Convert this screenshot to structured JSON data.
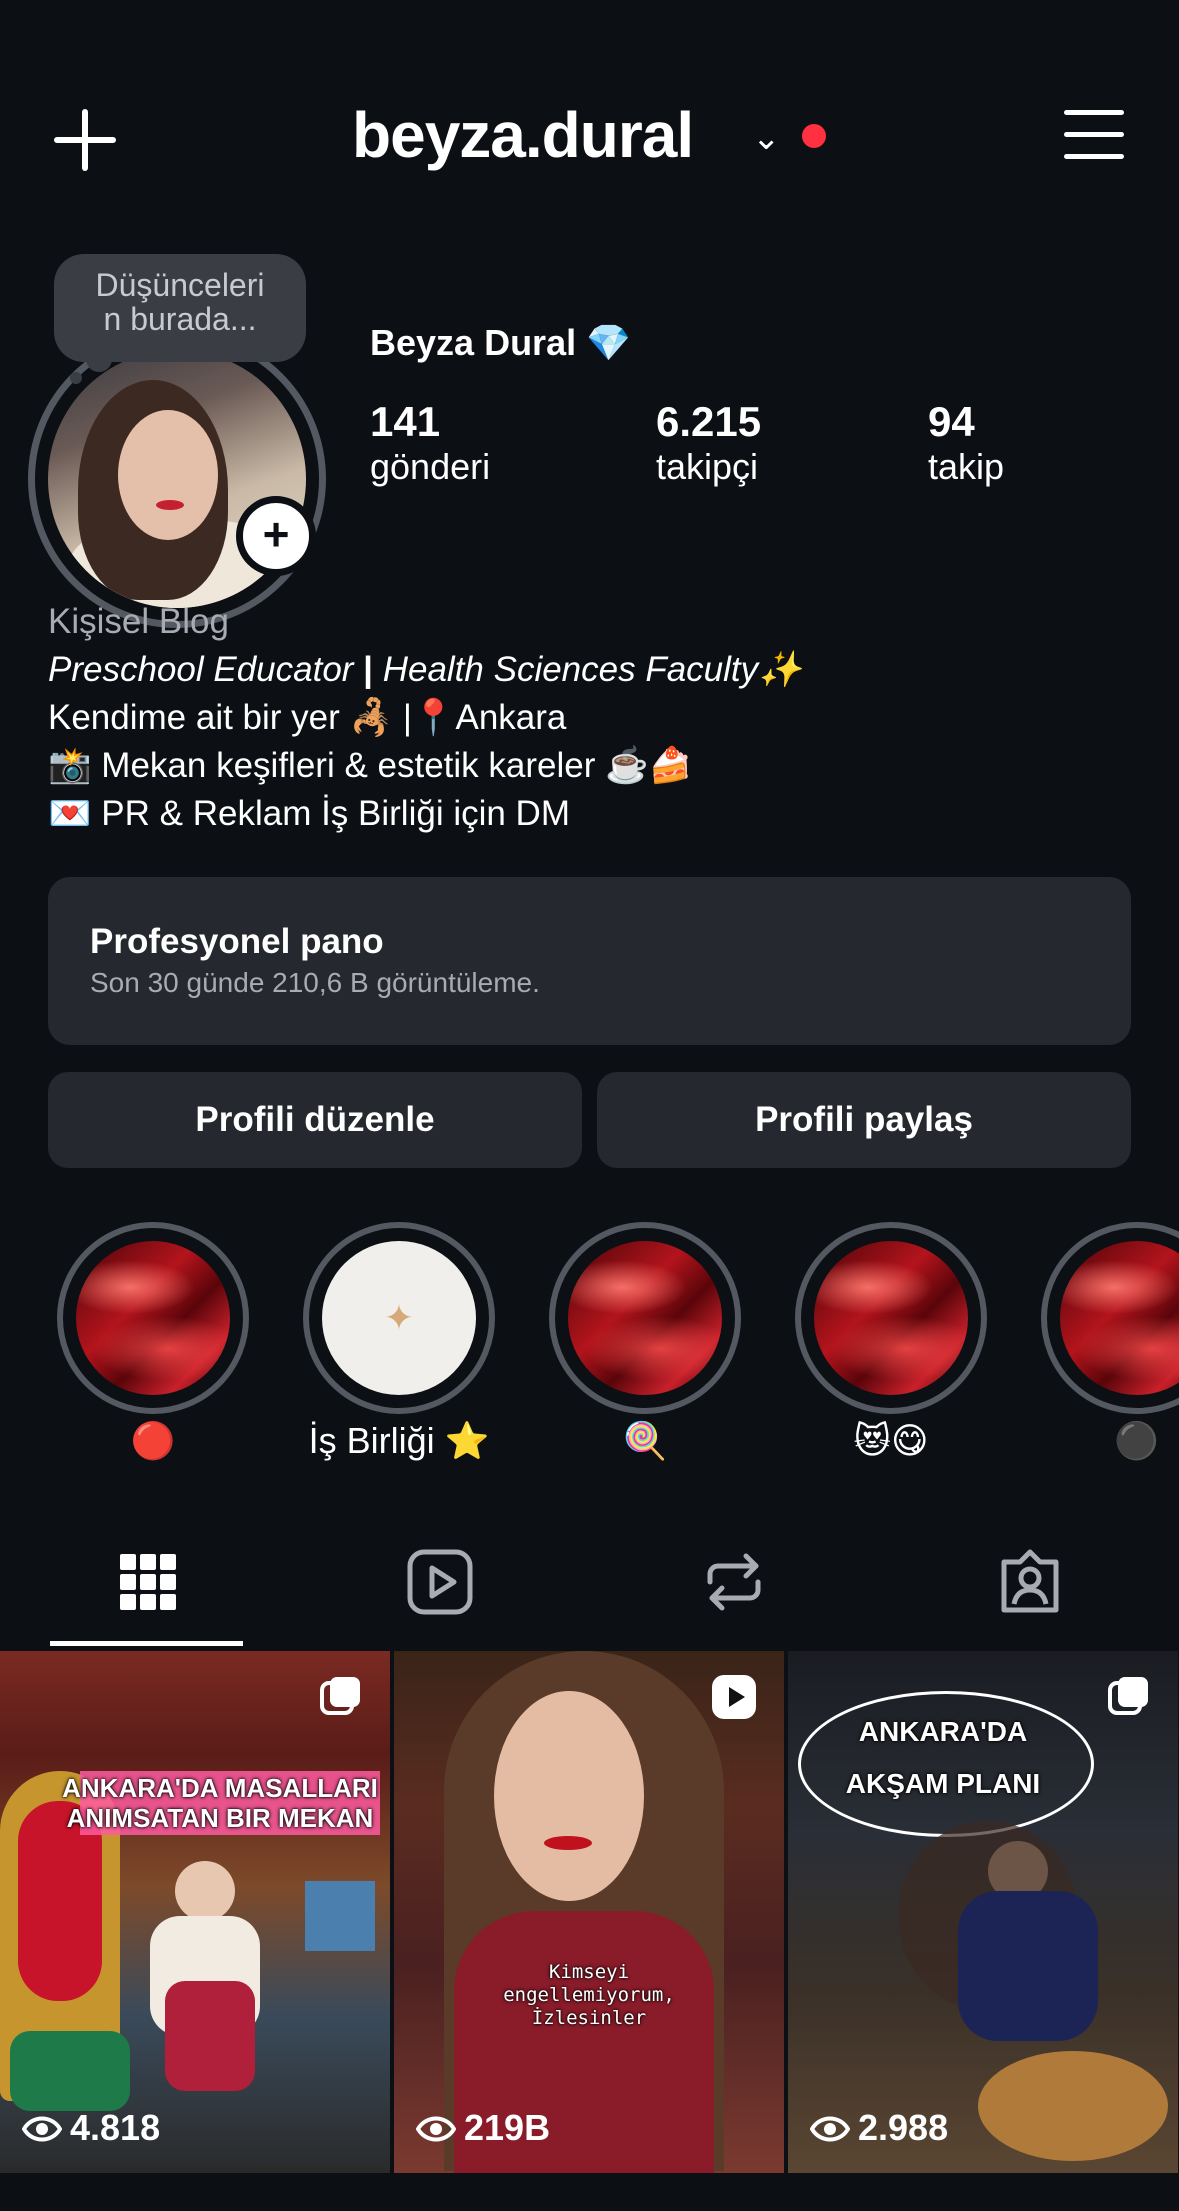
{
  "header": {
    "username": "beyza.dural",
    "chevron_icon": "chevron-down-icon",
    "notification_color": "#ff3040"
  },
  "profile": {
    "note_bubble": "Düşünceleri\nn burada...",
    "full_name": "Beyza Dural 💎",
    "stats": [
      {
        "value": "141",
        "label": "gönderi"
      },
      {
        "value": "6.215",
        "label": "takipçi"
      },
      {
        "value": "94",
        "label": "takip"
      }
    ],
    "category": "Kişisel Blog",
    "bio_line1_a": "Preschool Educator",
    "bio_line1_sep": " | ",
    "bio_line1_b": "Health Sciences Faculty✨",
    "bio_line2": "Kendime ait bir yer 🦂 |📍Ankara",
    "bio_line3": "📸 Mekan keşifleri & estetik kareler ☕️🍰",
    "bio_line4": "💌 PR & Reklam İş Birliği için DM"
  },
  "dashboard": {
    "title": "Profesyonel pano",
    "subtitle": "Son 30 günde 210,6 B görüntüleme."
  },
  "buttons": {
    "edit": "Profili düzenle",
    "share": "Profili paylaş"
  },
  "highlights": [
    {
      "label": "🔴"
    },
    {
      "label": "İş Birliği ⭐️"
    },
    {
      "label": "🍭"
    },
    {
      "label": "😻😋"
    },
    {
      "label": "⚫️"
    }
  ],
  "tabs": [
    "grid-icon",
    "reels-icon",
    "reposts-icon",
    "tagged-icon"
  ],
  "posts": [
    {
      "views": "4.818",
      "caption": "ANKARA'DA MASALLARI\nANIMSATAN BIR MEKAN",
      "type": "carousel"
    },
    {
      "views": "219B",
      "caption": "Kimseyi\nengellemiyorum,\nİzlesinler",
      "type": "reel"
    },
    {
      "views": "2.988",
      "caption": "ANKARA'DA\nAKŞAM PLANI",
      "type": "carousel"
    }
  ]
}
